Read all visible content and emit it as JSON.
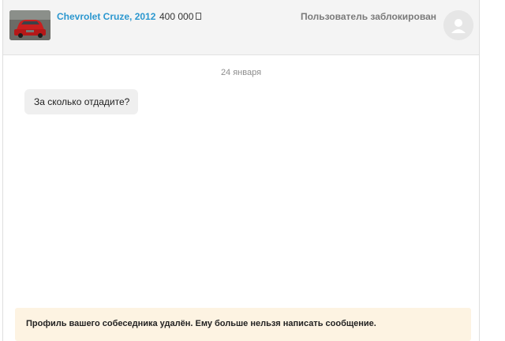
{
  "header": {
    "car_title": "Chevrolet Cruze, 2012",
    "price": "400 000",
    "currency_icon": "ruble-icon",
    "user_status": "Пользователь заблокирован",
    "avatar_icon": "user-avatar-icon"
  },
  "conversation": {
    "date": "24 января",
    "messages": [
      {
        "text": "За сколько отдадите?"
      }
    ]
  },
  "notice": {
    "text": "Профиль вашего собеседника удалён. Ему больше нельзя написать сообщение."
  },
  "colors": {
    "link": "#2b97cf",
    "header_bg": "#f4f4f4",
    "bubble_bg": "#efefef",
    "notice_bg": "#fdf3e2"
  }
}
